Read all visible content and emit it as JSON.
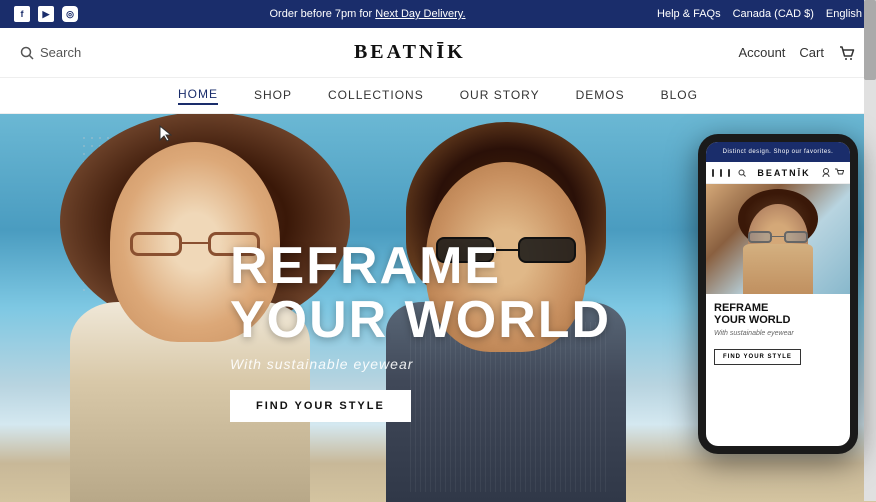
{
  "topbar": {
    "announcement": "Order before 7pm for ",
    "announcement_link": "Next Day Delivery.",
    "help": "Help & FAQs",
    "region": "Canada (CAD $)",
    "language": "English",
    "social_icons": [
      "facebook",
      "youtube",
      "instagram"
    ]
  },
  "header": {
    "search_placeholder": "Search",
    "logo": "BEATNĪK",
    "account": "Account",
    "cart": "Cart"
  },
  "nav": {
    "items": [
      {
        "label": "HOME",
        "active": true
      },
      {
        "label": "SHOP",
        "active": false
      },
      {
        "label": "COLLECTIONS",
        "active": false
      },
      {
        "label": "OUR STORY",
        "active": false
      },
      {
        "label": "DEMOS",
        "active": false
      },
      {
        "label": "BLOG",
        "active": false
      }
    ]
  },
  "hero": {
    "headline_line1": "REFRAME",
    "headline_line2": "YOUR WORLD",
    "subtext": "With sustainable eyewear",
    "cta_button": "FIND YOUR STYLE"
  },
  "phone": {
    "top_bar_text": "Distinct design. Shop our favorites.",
    "logo": "BEATNĪK",
    "headline_line1": "REFRAME",
    "headline_line2": "YOUR WORLD",
    "subtext": "With sustainable eyewear",
    "cta_button": "FIND YOUR STYLE"
  }
}
